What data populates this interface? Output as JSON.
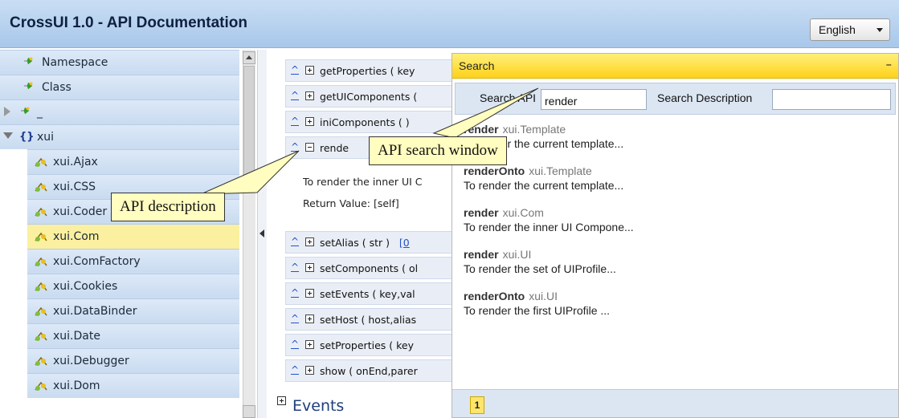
{
  "header": {
    "title": "CrossUI 1.0 - API Documentation",
    "language": "English"
  },
  "sidebar": {
    "items": [
      {
        "label": "Namespace",
        "icon": "namespace-icon"
      },
      {
        "label": "Class",
        "icon": "class-icon"
      },
      {
        "label": "_",
        "icon": "namespace-icon",
        "collapsed": true
      },
      {
        "label": "xui",
        "icon": "namespace-braces-icon",
        "expanded": true
      },
      {
        "label": "xui.Ajax"
      },
      {
        "label": "xui.CSS"
      },
      {
        "label": "xui.Coder"
      },
      {
        "label": "xui.Com",
        "selected": true
      },
      {
        "label": "xui.ComFactory"
      },
      {
        "label": "xui.Cookies"
      },
      {
        "label": "xui.DataBinder"
      },
      {
        "label": "xui.Date"
      },
      {
        "label": "xui.Debugger"
      },
      {
        "label": "xui.Dom"
      }
    ],
    "class_icon_braces": "{}"
  },
  "methods": {
    "items": [
      {
        "caret": "^",
        "text": "getProperties ( key"
      },
      {
        "caret": "^",
        "text": "getUIComponents ("
      },
      {
        "caret": "^",
        "text": "iniComponents ( )"
      },
      {
        "caret": "^",
        "text": "rende"
      },
      {
        "caret": "^",
        "text": "setAlias ( str )",
        "link": "[0"
      },
      {
        "caret": "^",
        "text": "setComponents ( ol"
      },
      {
        "caret": "^",
        "text": "setEvents ( key,val"
      },
      {
        "caret": "^",
        "text": "setHost ( host,alias"
      },
      {
        "caret": "^",
        "text": "setProperties ( key"
      },
      {
        "caret": "^",
        "text": "show ( onEnd,parer"
      }
    ],
    "description": {
      "line1": "To render the inner UI C",
      "line2": "Return Value: [self]"
    },
    "events_heading": "Events"
  },
  "search": {
    "title": "Search",
    "minimize": "–",
    "api_label": "Search API",
    "api_value": "render",
    "desc_label": "Search Description",
    "desc_value": "",
    "results": [
      {
        "name": "render",
        "cls": "xui.Template",
        "desc": "To render the current template..."
      },
      {
        "name": "renderOnto",
        "cls": "xui.Template",
        "desc": "To render the current template..."
      },
      {
        "name": "render",
        "cls": "xui.Com",
        "desc": "To render the inner UI Compone..."
      },
      {
        "name": "render",
        "cls": "xui.UI",
        "desc": "To render the set of UIProfile..."
      },
      {
        "name": "renderOnto",
        "cls": "xui.UI",
        "desc": "To render the first UIProfile ..."
      }
    ],
    "page": "1"
  },
  "callouts": {
    "search_window": "API search window",
    "description": "API description"
  },
  "colors": {
    "header_bg": "#b8d2ef",
    "search_titlebar": "#ffe03a",
    "selected_item": "#fbf0a0",
    "callout_bg": "#fffdbf"
  }
}
